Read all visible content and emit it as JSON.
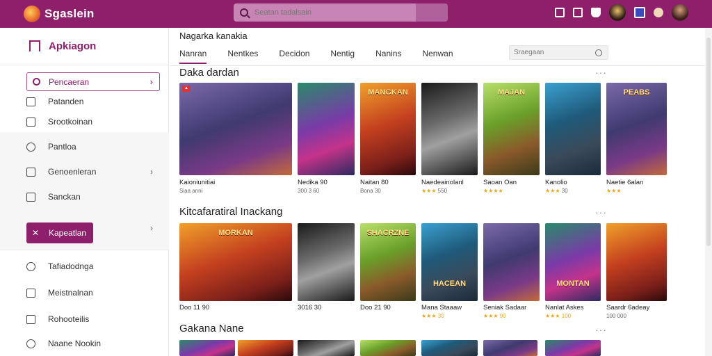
{
  "topbar": {
    "brand": "Sgaslein",
    "search_placeholder": "Seatan tadalsain"
  },
  "sidebar": {
    "title": "Apkiagon",
    "search_label": "Pencaeran",
    "items_top": [
      "Patanden",
      "Srootkoinan",
      "Pantloa",
      "Genoenleran",
      "Sanckan"
    ],
    "active": "Kapeatlan",
    "items_bottom": [
      "Tafiadodnga",
      "Meistnalnan",
      "Rohooteilis",
      "Naane Nookin"
    ]
  },
  "main": {
    "breadcrumb": "Nagarka kanakia",
    "tabs": [
      "Nanran",
      "Nentkes",
      "Decidon",
      "Nentig",
      "Nanins",
      "Nenwan"
    ],
    "filter_placeholder": "Sraegaan",
    "section1": {
      "title": "Daka dardan",
      "cards": [
        {
          "label": "Kaioniunitiai",
          "sub": "Siaa anni",
          "stars": "",
          "art_text": ""
        },
        {
          "label": "Nedika 90",
          "sub": "300 3 60",
          "stars": "",
          "art_text": ""
        },
        {
          "label": "Naitan 80",
          "sub": "Bona 30",
          "stars": "",
          "art_text": "MANGKAN"
        },
        {
          "label": "Naedeainolanl",
          "sub": "550",
          "stars": "★★★",
          "art_text": ""
        },
        {
          "label": "Saoan Oan",
          "sub": "",
          "stars": "★★★★",
          "art_text": "MAJAN"
        },
        {
          "label": "Kanolio",
          "sub": "30",
          "stars": "★★★",
          "art_text": ""
        },
        {
          "label": "Naetie 6alan",
          "sub": "",
          "stars": "★★★",
          "art_text": "PEABS"
        }
      ]
    },
    "section2": {
      "title": "Kitcafaratiral Inackang",
      "cards": [
        {
          "label": "Doo 11 90",
          "sub": "",
          "stars": "",
          "art_text": "MORKAN"
        },
        {
          "label": "3016 30",
          "sub": "",
          "stars": "",
          "art_text": ""
        },
        {
          "label": "Doo 21 90",
          "sub": "",
          "stars": "",
          "art_text": "SHACRZNE"
        },
        {
          "label": "Mana Staaaw",
          "sub": "",
          "stars": "★★★ 30",
          "art_text": "HACEAN"
        },
        {
          "label": "Seniak Sadaar",
          "sub": "",
          "stars": "★★★ 90",
          "art_text": ""
        },
        {
          "label": "Nanlat Askes",
          "sub": "",
          "stars": "★★★ 100",
          "art_text": "MONTAN"
        },
        {
          "label": "Saardr 6adeay",
          "sub": "100 000",
          "stars": "",
          "art_text": ""
        }
      ]
    },
    "section3": {
      "title": "Gakana Nane"
    }
  }
}
